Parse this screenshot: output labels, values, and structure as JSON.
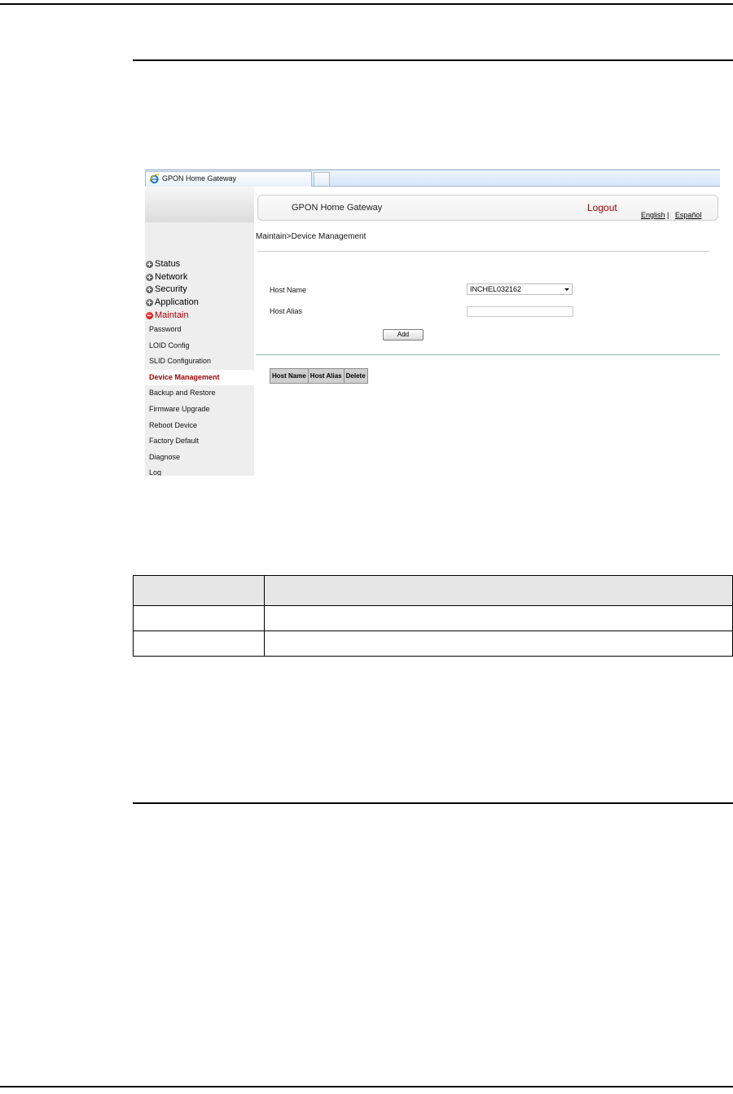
{
  "browser": {
    "tab_title": "GPON Home Gateway",
    "colors": {
      "accent_red": "#b00000",
      "active_item_red": "#9a0000"
    }
  },
  "header": {
    "brand": "GPON Home Gateway",
    "logout": "Logout",
    "lang_english": "English",
    "lang_separator": "|",
    "lang_spanish": "Español"
  },
  "sidebar": {
    "groups": [
      "Status",
      "Network",
      "Security",
      "Application",
      "Maintain"
    ],
    "active_group": "Maintain",
    "items": [
      "Password",
      "LOID Config",
      "SLID Configuration",
      "Device Management",
      "Backup and Restore",
      "Firmware Upgrade",
      "Reboot Device",
      "Factory Default",
      "Diagnose",
      "Log"
    ],
    "active_item": "Device Management"
  },
  "main": {
    "breadcrumb": "Maintain>Device Management",
    "host_name_label": "Host Name",
    "host_name_value": "INCHEL032162",
    "host_alias_label": "Host Alias",
    "host_alias_value": "",
    "add_button": "Add",
    "table_headers": [
      "Host Name",
      "Host Alias",
      "Delete"
    ]
  }
}
